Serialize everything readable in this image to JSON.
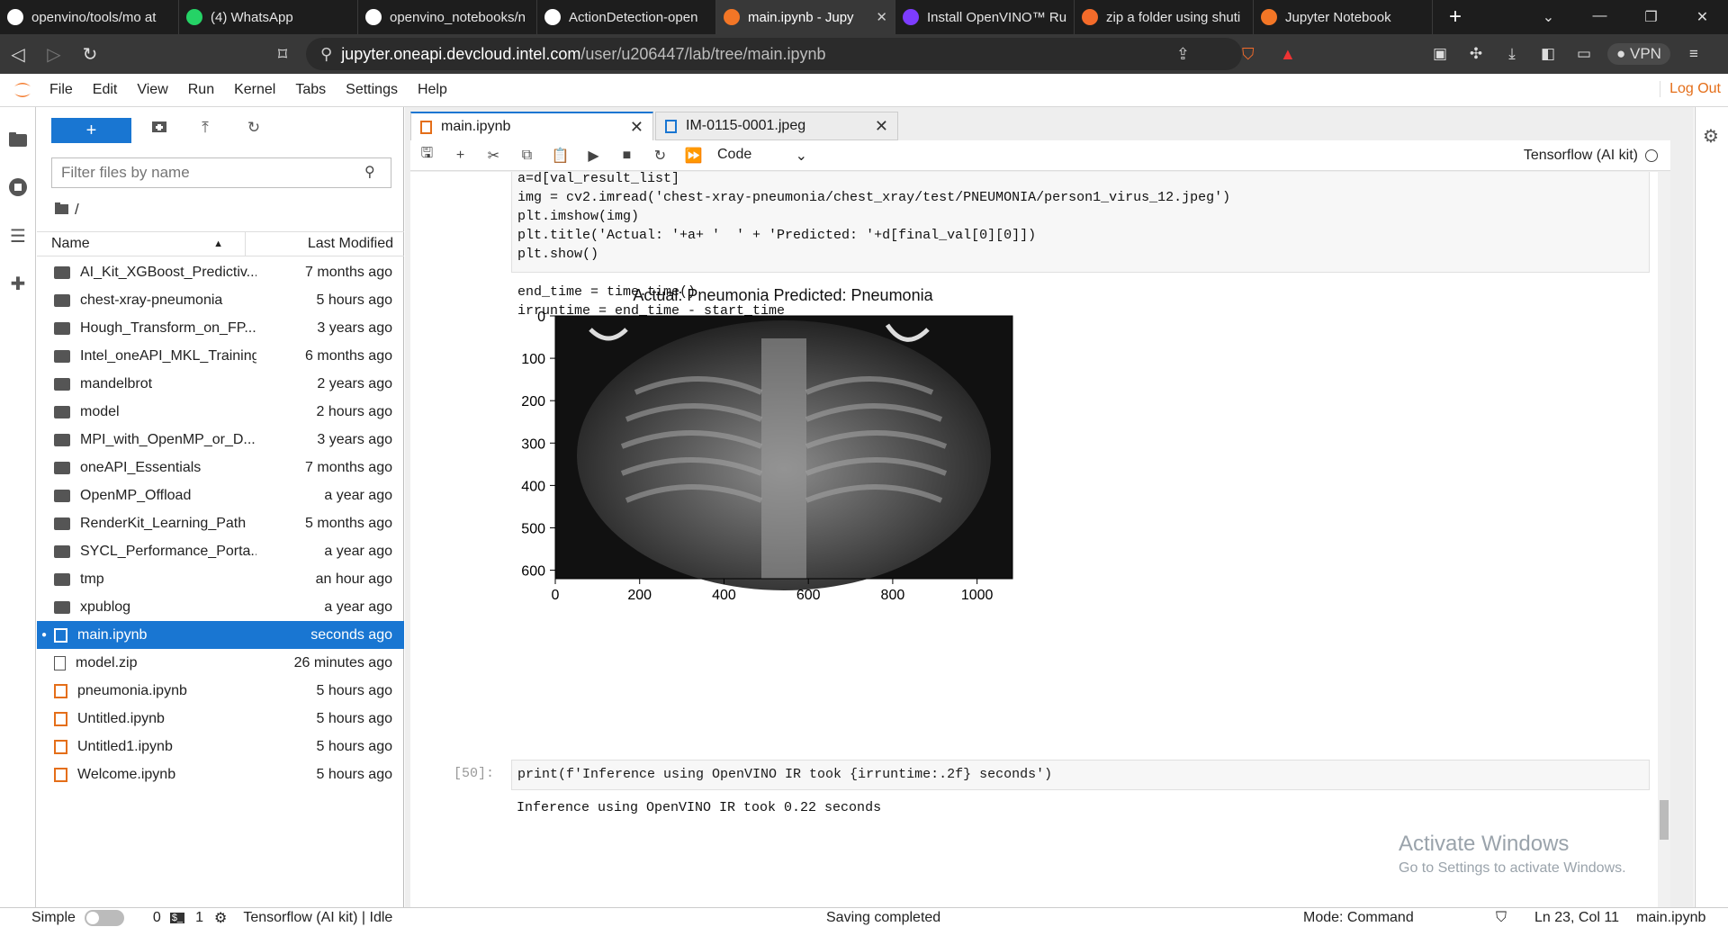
{
  "browser": {
    "tabs": [
      {
        "title": "openvino/tools/mo at",
        "icon": "github-icon",
        "color": "#ffffff"
      },
      {
        "title": "(4) WhatsApp",
        "icon": "whatsapp-icon",
        "color": "#25d366"
      },
      {
        "title": "openvino_notebooks/n",
        "icon": "github-icon",
        "color": "#ffffff"
      },
      {
        "title": "ActionDetection-open",
        "icon": "github-icon",
        "color": "#ffffff"
      },
      {
        "title": "main.ipynb - Jupy",
        "icon": "jupyter-icon",
        "color": "#f37626",
        "active": true
      },
      {
        "title": "Install OpenVINO™ Ru",
        "icon": "openvino-icon",
        "color": "#7d3cff"
      },
      {
        "title": "zip a folder using shuti",
        "icon": "brave-icon",
        "color": "#f46b2a"
      },
      {
        "title": "Jupyter Notebook",
        "icon": "jupyter-icon",
        "color": "#f37626"
      }
    ],
    "url_host": "jupyter.oneapi.devcloud.intel.com",
    "url_path": "/user/u206447/lab/tree/main.ipynb",
    "vpn_label": "VPN"
  },
  "menu": {
    "items": [
      "File",
      "Edit",
      "View",
      "Run",
      "Kernel",
      "Tabs",
      "Settings",
      "Help"
    ],
    "logout": "Log Out"
  },
  "filebrowser": {
    "filter_placeholder": "Filter files by name",
    "breadcrumb": "/",
    "col_name": "Name",
    "col_modified": "Last Modified",
    "files": [
      {
        "name": "AI_Kit_XGBoost_Predictiv...",
        "modified": "7 months ago",
        "type": "folder"
      },
      {
        "name": "chest-xray-pneumonia",
        "modified": "5 hours ago",
        "type": "folder"
      },
      {
        "name": "Hough_Transform_on_FP...",
        "modified": "3 years ago",
        "type": "folder"
      },
      {
        "name": "Intel_oneAPI_MKL_Training",
        "modified": "6 months ago",
        "type": "folder"
      },
      {
        "name": "mandelbrot",
        "modified": "2 years ago",
        "type": "folder"
      },
      {
        "name": "model",
        "modified": "2 hours ago",
        "type": "folder"
      },
      {
        "name": "MPI_with_OpenMP_or_D...",
        "modified": "3 years ago",
        "type": "folder"
      },
      {
        "name": "oneAPI_Essentials",
        "modified": "7 months ago",
        "type": "folder"
      },
      {
        "name": "OpenMP_Offload",
        "modified": "a year ago",
        "type": "folder"
      },
      {
        "name": "RenderKit_Learning_Path",
        "modified": "5 months ago",
        "type": "folder"
      },
      {
        "name": "SYCL_Performance_Porta...",
        "modified": "a year ago",
        "type": "folder"
      },
      {
        "name": "tmp",
        "modified": "an hour ago",
        "type": "folder"
      },
      {
        "name": "xpublog",
        "modified": "a year ago",
        "type": "folder"
      },
      {
        "name": "main.ipynb",
        "modified": "seconds ago",
        "type": "notebook",
        "selected": true
      },
      {
        "name": "model.zip",
        "modified": "26 minutes ago",
        "type": "file"
      },
      {
        "name": "pneumonia.ipynb",
        "modified": "5 hours ago",
        "type": "notebook"
      },
      {
        "name": "Untitled.ipynb",
        "modified": "5 hours ago",
        "type": "notebook"
      },
      {
        "name": "Untitled1.ipynb",
        "modified": "5 hours ago",
        "type": "notebook"
      },
      {
        "name": "Welcome.ipynb",
        "modified": "5 hours ago",
        "type": "notebook"
      }
    ]
  },
  "doc_tabs": [
    {
      "label": "main.ipynb",
      "active": true
    },
    {
      "label": "IM-0115-0001.jpeg",
      "active": false
    }
  ],
  "notebook": {
    "cell_type": "Code",
    "kernel": "Tensorflow (AI kit)",
    "code_lines": [
      "a=d[val_result_list]",
      "img = cv2.imread('chest-xray-pneumonia/chest_xray/test/PNEUMONIA/person1_virus_12.jpeg')",
      "plt.imshow(img)",
      "plt.title('Actual: '+a+ '  ' + 'Predicted: '+d[final_val[0][0]])",
      "plt.show()",
      "",
      "end_time = time.time()",
      "irruntime = end_time - start_time"
    ],
    "plot_title": "Actual: Pneumonia  Predicted: Pneumonia",
    "y_ticks": [
      "0",
      "100",
      "200",
      "300",
      "400",
      "500",
      "600"
    ],
    "x_ticks": [
      "0",
      "200",
      "400",
      "600",
      "800",
      "1000"
    ],
    "prompt": "[50]:",
    "cell2_code": "print(f'Inference using OpenVINO IR took {irruntime:.2f} seconds')",
    "cell2_output": "Inference using OpenVINO IR took 0.22 seconds"
  },
  "watermark": {
    "line1": "Activate Windows",
    "line2": "Go to Settings to activate Windows."
  },
  "status": {
    "mode_label": "Simple",
    "count0": "0",
    "count1": "1",
    "kernel_status": "Tensorflow (AI kit) | Idle",
    "saving": "Saving completed",
    "mode": "Mode: Command",
    "position": "Ln 23, Col 11",
    "file": "main.ipynb"
  }
}
